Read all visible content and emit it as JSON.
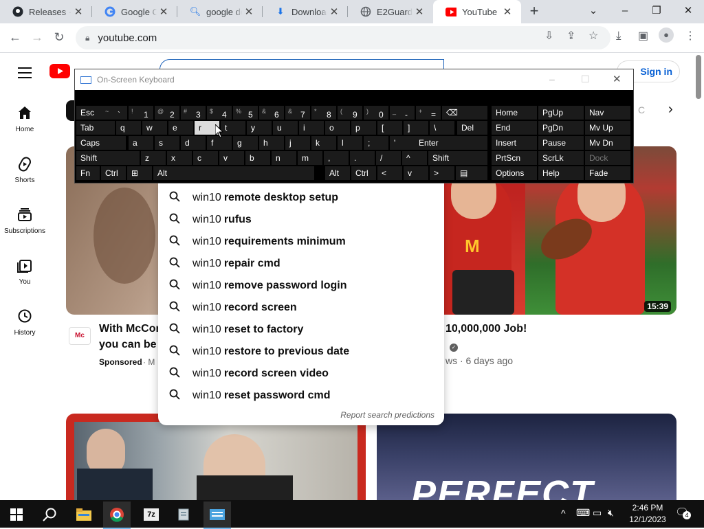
{
  "browser": {
    "tabs": [
      {
        "title": "Releases · ",
        "icon": "github-icon"
      },
      {
        "title": "Google Ch",
        "icon": "google-icon"
      },
      {
        "title": "google do",
        "icon": "search-icon"
      },
      {
        "title": "Download",
        "icon": "download-icon"
      },
      {
        "title": "E2Guardia",
        "icon": "globe-icon"
      },
      {
        "title": "YouTube",
        "icon": "youtube-icon"
      }
    ],
    "new_tab": "+",
    "url": "youtube.com"
  },
  "youtube": {
    "logo_text": "YouTube",
    "sign_in": "Sign in",
    "search_query": "win10",
    "sidebar": [
      {
        "label": "Home",
        "icon": "home-icon"
      },
      {
        "label": "Shorts",
        "icon": "shorts-icon"
      },
      {
        "label": "Subscriptions",
        "icon": "subscriptions-icon"
      },
      {
        "label": "You",
        "icon": "you-icon"
      },
      {
        "label": "History",
        "icon": "history-icon"
      }
    ],
    "videos": [
      {
        "title_line1": "With McCor",
        "title_line2": "you can be s",
        "meta": "Sponsored",
        "meta2": "· M"
      },
      {
        "title_line1": "10,000,000 Job!",
        "meta": "ws · 6 days ago",
        "duration": "15:39"
      }
    ],
    "suggestions": [
      {
        "prefix": "win10",
        "rest": "remote desktop setup"
      },
      {
        "prefix": "win10",
        "rest": "rufus"
      },
      {
        "prefix": "win10",
        "rest": "requirements minimum"
      },
      {
        "prefix": "win10",
        "rest": "repair cmd"
      },
      {
        "prefix": "win10",
        "rest": "remove password login"
      },
      {
        "prefix": "win10",
        "rest": "record screen"
      },
      {
        "prefix": "win10",
        "rest": "reset to factory"
      },
      {
        "prefix": "win10",
        "rest": "restore to previous date"
      },
      {
        "prefix": "win10",
        "rest": "record screen video"
      },
      {
        "prefix": "win10",
        "rest": "reset password cmd"
      }
    ],
    "report": "Report search predictions",
    "bottom_text": "PERFECT"
  },
  "osk": {
    "title": "On-Screen Keyboard",
    "row1": [
      [
        "Esc",
        ""
      ],
      [
        "`",
        "~"
      ],
      [
        "1",
        "!"
      ],
      [
        "2",
        "@"
      ],
      [
        "3",
        "#"
      ],
      [
        "4",
        "$"
      ],
      [
        "5",
        "%"
      ],
      [
        "6",
        "&"
      ],
      [
        "7",
        "&"
      ],
      [
        "8",
        "*"
      ],
      [
        "9",
        "("
      ],
      [
        "0",
        ")"
      ],
      [
        "-",
        "_"
      ],
      [
        "=",
        "+"
      ],
      [
        "⌫",
        ""
      ]
    ],
    "row2": [
      "Tab",
      "q",
      "w",
      "e",
      "r",
      "t",
      "y",
      "u",
      "i",
      "o",
      "p",
      "[",
      "]",
      "\\",
      "Del"
    ],
    "row3": [
      "Caps",
      "a",
      "s",
      "d",
      "f",
      "g",
      "h",
      "j",
      "k",
      "l",
      ";",
      "'",
      "Enter"
    ],
    "row4": [
      "Shift",
      "z",
      "x",
      "c",
      "v",
      "b",
      "n",
      "m",
      ",",
      ".",
      "/",
      "^",
      "Shift"
    ],
    "row5": [
      "Fn",
      "Ctrl",
      "⊞",
      "Alt",
      "Alt",
      "Ctrl",
      "<",
      "v",
      ">",
      "▤"
    ],
    "nav": [
      [
        "Home",
        "PgUp",
        "Nav"
      ],
      [
        "End",
        "PgDn",
        "Mv Up"
      ],
      [
        "Insert",
        "Pause",
        "Mv Dn"
      ],
      [
        "PrtScn",
        "ScrLk",
        "Dock"
      ],
      [
        "Options",
        "Help",
        "Fade"
      ]
    ]
  },
  "taskbar": {
    "time": "2:46 PM",
    "date": "12/1/2023",
    "notifications": "4"
  }
}
